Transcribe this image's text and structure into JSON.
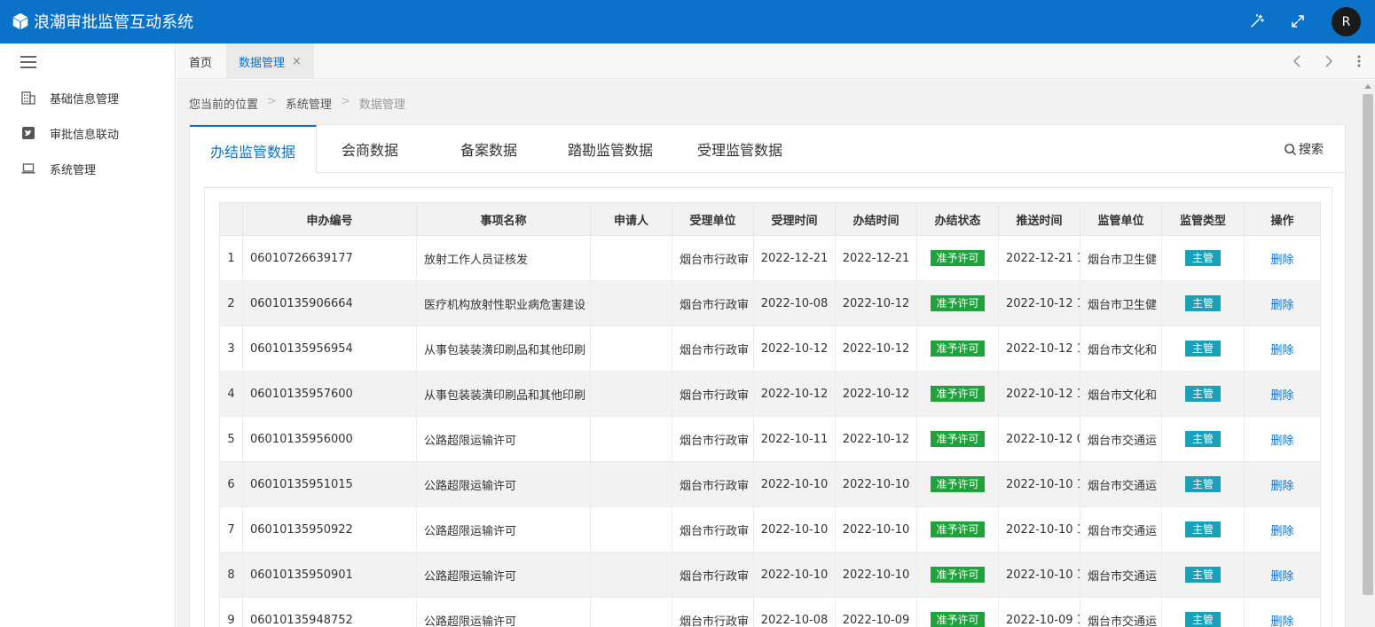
{
  "app": {
    "title": "浪潮审批监管互动系统",
    "user_initial": "R"
  },
  "header_icons": [
    "magic-wand-icon",
    "fullscreen-icon"
  ],
  "sidebar": {
    "items": [
      {
        "label": "基础信息管理",
        "icon": "building-icon"
      },
      {
        "label": "审批信息联动",
        "icon": "twitter-icon"
      },
      {
        "label": "系统管理",
        "icon": "laptop-icon"
      }
    ]
  },
  "tabs": [
    {
      "label": "首页"
    },
    {
      "label": "数据管理",
      "close": "×"
    }
  ],
  "breadcrumb": {
    "prefix": "您当前的位置",
    "level1": "系统管理",
    "level2": "数据管理",
    "sep": ">"
  },
  "content_tabs": [
    {
      "label": "办结监管数据"
    },
    {
      "label": "会商数据"
    },
    {
      "label": "备案数据"
    },
    {
      "label": "踏勘监管数据"
    },
    {
      "label": "受理监管数据"
    }
  ],
  "search_label": "搜索",
  "table": {
    "headers": [
      "申办编号",
      "事项名称",
      "申请人",
      "受理单位",
      "受理时间",
      "办结时间",
      "办结状态",
      "推送时间",
      "监管单位",
      "监管类型",
      "操作"
    ],
    "rows": [
      {
        "idx": "1",
        "code": "06010726639177",
        "name": "放射工作人员证核发",
        "applicant": "",
        "unit": "烟台市行政审",
        "accept": "2022-12-21",
        "finish": "2022-12-21",
        "status": "准予许可",
        "push": "2022-12-21 1",
        "supervisor": "烟台市卫生健",
        "type": "主管",
        "action": "删除"
      },
      {
        "idx": "2",
        "code": "06010135906664",
        "name": "医疗机构放射性职业病危害建设",
        "applicant": "",
        "unit": "烟台市行政审",
        "accept": "2022-10-08",
        "finish": "2022-10-12",
        "status": "准予许可",
        "push": "2022-10-12 1",
        "supervisor": "烟台市卫生健",
        "type": "主管",
        "action": "删除"
      },
      {
        "idx": "3",
        "code": "06010135956954",
        "name": "从事包装装潢印刷品和其他印刷",
        "applicant": "",
        "unit": "烟台市行政审",
        "accept": "2022-10-12",
        "finish": "2022-10-12",
        "status": "准予许可",
        "push": "2022-10-12 1",
        "supervisor": "烟台市文化和",
        "type": "主管",
        "action": "删除"
      },
      {
        "idx": "4",
        "code": "06010135957600",
        "name": "从事包装装潢印刷品和其他印刷",
        "applicant": "",
        "unit": "烟台市行政审",
        "accept": "2022-10-12",
        "finish": "2022-10-12",
        "status": "准予许可",
        "push": "2022-10-12 1",
        "supervisor": "烟台市文化和",
        "type": "主管",
        "action": "删除"
      },
      {
        "idx": "5",
        "code": "06010135956000",
        "name": "公路超限运输许可",
        "applicant": "",
        "unit": "烟台市行政审",
        "accept": "2022-10-11",
        "finish": "2022-10-12",
        "status": "准予许可",
        "push": "2022-10-12 0",
        "supervisor": "烟台市交通运",
        "type": "主管",
        "action": "删除"
      },
      {
        "idx": "6",
        "code": "06010135951015",
        "name": "公路超限运输许可",
        "applicant": "",
        "unit": "烟台市行政审",
        "accept": "2022-10-10",
        "finish": "2022-10-10",
        "status": "准予许可",
        "push": "2022-10-10 1",
        "supervisor": "烟台市交通运",
        "type": "主管",
        "action": "删除"
      },
      {
        "idx": "7",
        "code": "06010135950922",
        "name": "公路超限运输许可",
        "applicant": "",
        "unit": "烟台市行政审",
        "accept": "2022-10-10",
        "finish": "2022-10-10",
        "status": "准予许可",
        "push": "2022-10-10 1",
        "supervisor": "烟台市交通运",
        "type": "主管",
        "action": "删除"
      },
      {
        "idx": "8",
        "code": "06010135950901",
        "name": "公路超限运输许可",
        "applicant": "",
        "unit": "烟台市行政审",
        "accept": "2022-10-10",
        "finish": "2022-10-10",
        "status": "准予许可",
        "push": "2022-10-10 1",
        "supervisor": "烟台市交通运",
        "type": "主管",
        "action": "删除"
      },
      {
        "idx": "9",
        "code": "06010135948752",
        "name": "公路超限运输许可",
        "applicant": "",
        "unit": "烟台市行政审",
        "accept": "2022-10-08",
        "finish": "2022-10-09",
        "status": "准予许可",
        "push": "2022-10-09 1",
        "supervisor": "烟台市交通运",
        "type": "主管",
        "action": "删除"
      }
    ]
  },
  "colors": {
    "primary": "#0a72c9",
    "status_ok": "#1ea33c",
    "type_badge": "#1aa0b8"
  }
}
